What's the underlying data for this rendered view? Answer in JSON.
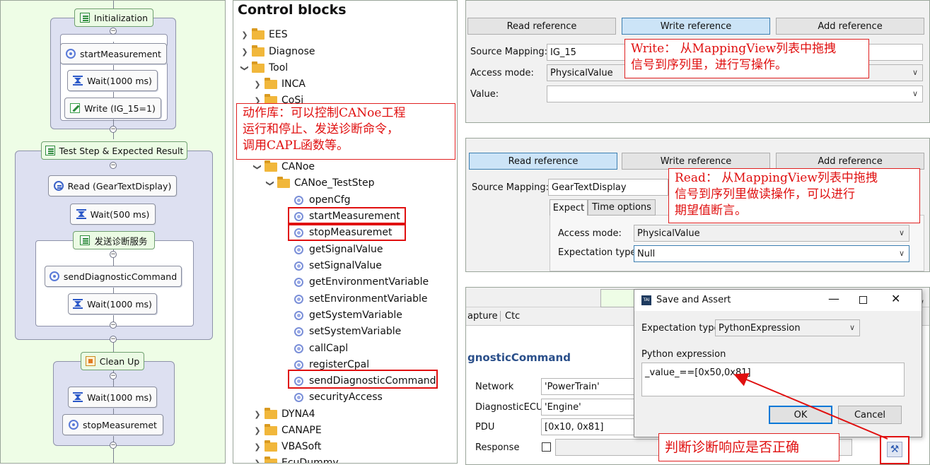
{
  "flow": {
    "init": {
      "title": "Initialization",
      "steps": [
        "startMeasurement",
        "Wait(1000 ms)",
        "Write (IG_15=1)"
      ]
    },
    "test_step": {
      "title": "Test Step & Expected Result",
      "steps": [
        "Read (GearTextDisplay)",
        "Wait(500 ms)"
      ],
      "sub": {
        "title": "发送诊断服务",
        "steps": [
          "sendDiagnosticCommand",
          "Wait(1000 ms)"
        ]
      }
    },
    "cleanup": {
      "title": "Clean Up",
      "steps": [
        "Wait(1000 ms)",
        "stopMeasuremet"
      ]
    }
  },
  "tree": {
    "title": "Control blocks",
    "folders_top": [
      "EES",
      "Diagnose",
      "Tool",
      "INCA",
      "CoSi"
    ],
    "canoe": "CANoe",
    "canoe_teststep": "CANoe_TestStep",
    "leaves": [
      "openCfg",
      "startMeasurement",
      "stopMeasuremet",
      "getSignalValue",
      "setSignalValue",
      "getEnvironmentVariable",
      "setEnvironmentVariable",
      "getSystemVariable",
      "setSystemVariable",
      "callCapl",
      "registerCpal",
      "sendDiagnosticCommand",
      "securityAccess"
    ],
    "folders_bottom": [
      "DYNA4",
      "CANAPE",
      "VBASoft",
      "EcuDummy"
    ],
    "note": [
      "动作库：可以控制CANoe工程",
      "运行和停止、发送诊断命令，",
      "调用CAPL函数等。"
    ]
  },
  "write_panel": {
    "buttons": [
      "Read reference",
      "Write reference",
      "Add reference"
    ],
    "source_mapping_label": "Source Mapping:",
    "source_mapping_value": "IG_15",
    "access_mode_label": "Access mode:",
    "access_mode_value": "PhysicalValue",
    "value_label": "Value:",
    "note": [
      "Write： 从MappingView列表中拖拽",
      "信号到序列里，进行写操作。"
    ]
  },
  "read_panel": {
    "buttons": [
      "Read reference",
      "Write reference",
      "Add reference"
    ],
    "source_mapping_label": "Source Mapping:",
    "source_mapping_value": "GearTextDisplay",
    "tabs": [
      "Expect",
      "Time options"
    ],
    "access_mode_label": "Access mode:",
    "access_mode_value": "PhysicalValue",
    "expectation_type_label": "Expectation type:",
    "expectation_type_value": "Null",
    "note": [
      "Read： 从MappingView列表中拖拽",
      "信号到序列里做读操作，可以进行",
      "期望值断言。"
    ]
  },
  "assert_panel": {
    "tabs": [
      "apture",
      "Ctc"
    ],
    "section_title": "gnosticCommand",
    "network_label": "Network",
    "network_value": "'PowerTrain'",
    "ecu_label": "DiagnosticECU",
    "ecu_value": "'Engine'",
    "pdu_label": "PDU",
    "pdu_value": "[0x10, 0x81]",
    "response_label": "Response",
    "dialog": {
      "title": "Save and Assert",
      "expectation_type_label": "Expectation type:",
      "expectation_type_value": "PythonExpression",
      "python_label": "Python expression",
      "python_value": "_value_==[0x50,0x81]",
      "ok": "OK",
      "cancel": "Cancel"
    },
    "note": "判断诊断响应是否正确",
    "accent": "#e01010"
  }
}
